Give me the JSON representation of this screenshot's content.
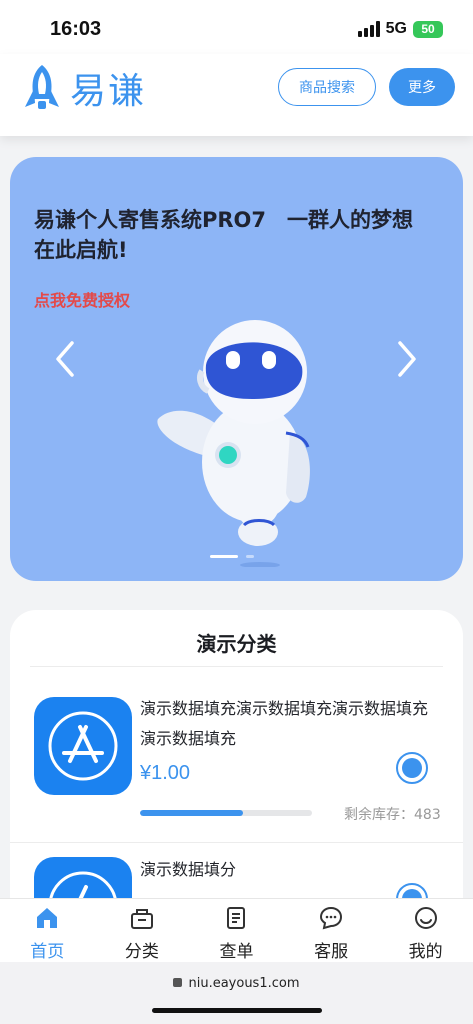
{
  "status": {
    "time": "16:03",
    "network": "5G",
    "battery": "50"
  },
  "header": {
    "logo_text": "易谦",
    "search_button": "商品搜索",
    "more_button": "更多"
  },
  "banner": {
    "title": "易谦个人寄售系统PRO7　一群人的梦想在此启航!",
    "link": "点我免费授权",
    "active_slide": 1,
    "slide_count": 2
  },
  "category": {
    "title": "演示分类",
    "products": [
      {
        "name": "演示数据填充演示数据填充演示数据填充演示数据填充",
        "price": "¥1.00",
        "stock_label": "剩余库存：483",
        "progress": 0.6,
        "selected": true
      },
      {
        "name": "演示数据填分",
        "price": "",
        "stock_label": "",
        "progress": 0,
        "selected": true
      }
    ]
  },
  "tabbar": {
    "items": [
      {
        "label": "首页",
        "icon": "home-icon",
        "active": true
      },
      {
        "label": "分类",
        "icon": "basket-icon",
        "active": false
      },
      {
        "label": "查单",
        "icon": "document-icon",
        "active": false
      },
      {
        "label": "客服",
        "icon": "chat-icon",
        "active": false
      },
      {
        "label": "我的",
        "icon": "profile-icon",
        "active": false
      }
    ]
  },
  "browser": {
    "url": "niu.eayous1.com"
  },
  "colors": {
    "accent": "#3c93ee",
    "banner_bg": "#8db5f6",
    "link_red": "#e34a4a"
  }
}
